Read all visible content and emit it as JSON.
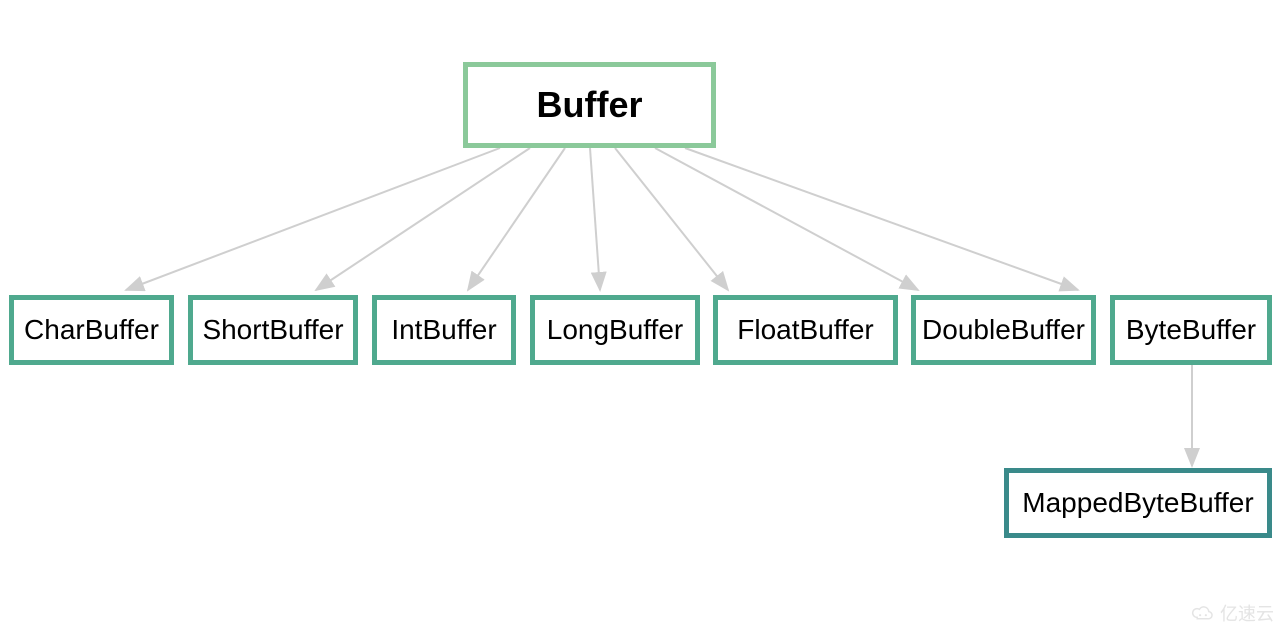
{
  "diagram": {
    "root": {
      "label": "Buffer"
    },
    "children": [
      {
        "id": "CharBuffer",
        "label": "CharBuffer"
      },
      {
        "id": "ShortBuffer",
        "label": "ShortBuffer"
      },
      {
        "id": "IntBuffer",
        "label": "IntBuffer"
      },
      {
        "id": "LongBuffer",
        "label": "LongBuffer"
      },
      {
        "id": "FloatBuffer",
        "label": "FloatBuffer"
      },
      {
        "id": "DoubleBuffer",
        "label": "DoubleBuffer"
      },
      {
        "id": "ByteBuffer",
        "label": "ByteBuffer"
      }
    ],
    "grandchild": {
      "parent": "ByteBuffer",
      "label": "MappedByteBuffer"
    }
  },
  "watermark": {
    "text": "亿速云"
  },
  "colors": {
    "root_border": "#8bc99a",
    "child_border": "#4fa98e",
    "grandchild_border": "#3a8a8a",
    "arrow": "#cfcfcf"
  }
}
